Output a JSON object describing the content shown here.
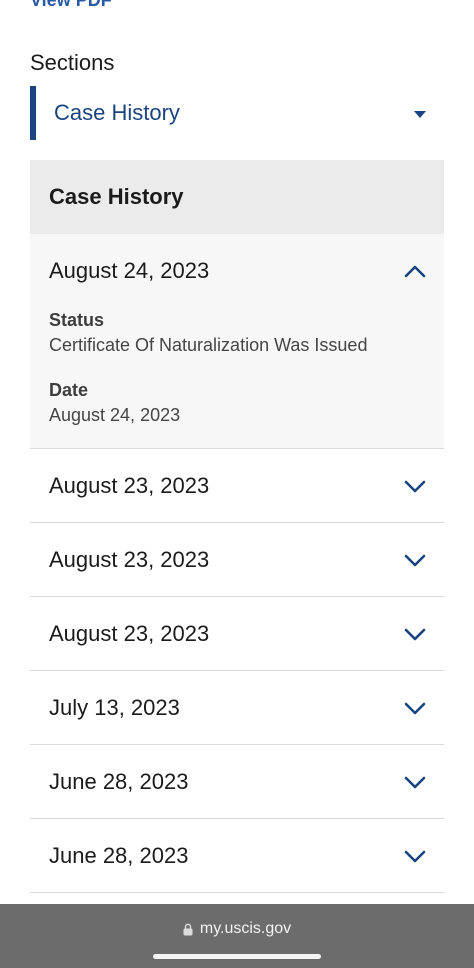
{
  "top_link": "View PDF",
  "sections": {
    "label": "Sections",
    "selected": "Case History"
  },
  "history": {
    "title": "Case History",
    "items": [
      {
        "date": "August 24, 2023",
        "expanded": true,
        "status_label": "Status",
        "status_value": "Certificate Of Naturalization Was Issued",
        "date_label": "Date",
        "date_value": "August 24, 2023"
      },
      {
        "date": "August 23, 2023",
        "expanded": false
      },
      {
        "date": "August 23, 2023",
        "expanded": false
      },
      {
        "date": "August 23, 2023",
        "expanded": false
      },
      {
        "date": "July 13, 2023",
        "expanded": false
      },
      {
        "date": "June 28, 2023",
        "expanded": false
      },
      {
        "date": "June 28, 2023",
        "expanded": false
      }
    ]
  },
  "browser": {
    "url": "my.uscis.gov"
  },
  "colors": {
    "accent": "#1a4480",
    "link": "#2a5aa6",
    "header_bg": "#ebebeb",
    "expanded_bg": "#f7f7f7",
    "browser_bar": "#6c6c6c"
  }
}
